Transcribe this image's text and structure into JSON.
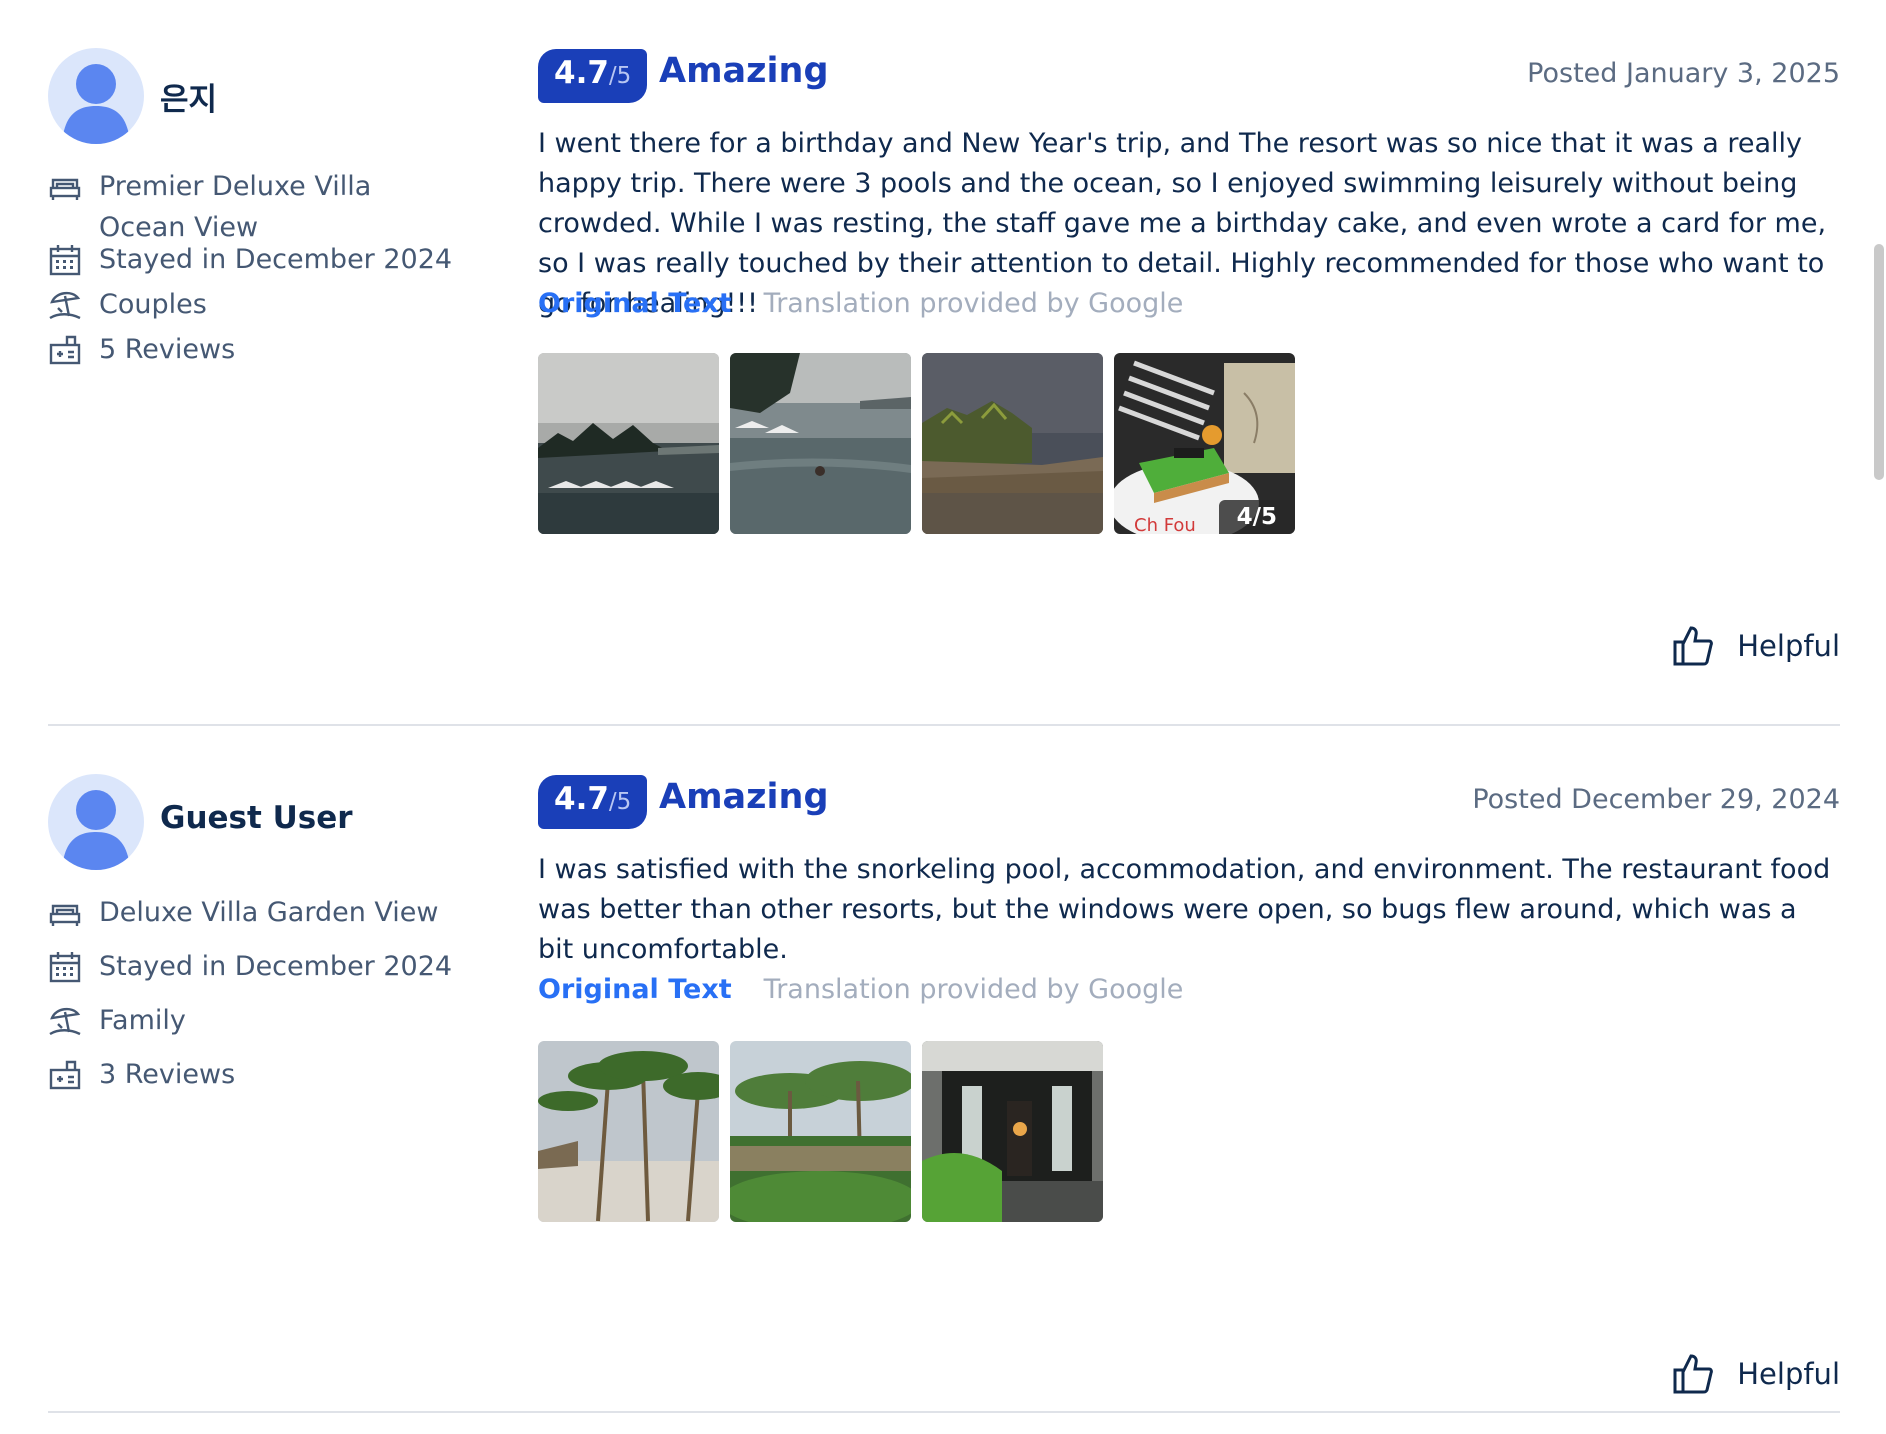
{
  "reviews": [
    {
      "user": {
        "name": "은지",
        "room": "Premier Deluxe Villa Ocean View",
        "stay": "Stayed in December 2024",
        "trip_type": "Couples",
        "review_count": "5 Reviews"
      },
      "score": "4.7",
      "score_max": "/5",
      "score_label": "Amazing",
      "posted": "Posted January 3, 2025",
      "text": "I went there for a birthday and New Year's trip, and The resort was so nice that it was a really happy trip. There were 3 pools and the ocean, so I enjoyed swimming leisurely without being crowded. While I was resting, the staff gave me a birthday cake, and even wrote a card for me, so I was really touched by their attention to detail. Highly recommended for those who want to go for healing!!!",
      "original_link": "Original Text",
      "translation_note": "Translation provided by Google",
      "photo_count": "4/5",
      "helpful_label": "Helpful"
    },
    {
      "user": {
        "name": "Guest User",
        "room": "Deluxe Villa Garden View",
        "stay": "Stayed in December 2024",
        "trip_type": "Family",
        "review_count": "3 Reviews"
      },
      "score": "4.7",
      "score_max": "/5",
      "score_label": "Amazing",
      "posted": "Posted December 29, 2024",
      "text": "I was satisfied with the snorkeling pool, accommodation, and environment. The restaurant food was better than other resorts, but the windows were open, so bugs flew around, which was a bit uncomfortable.",
      "original_link": "Original Text",
      "translation_note": "Translation provided by Google",
      "helpful_label": "Helpful"
    }
  ],
  "colors": {
    "brand": "#1a3fb8",
    "link": "#2870f5",
    "text": "#0f294d",
    "muted": "#5b6b82",
    "divider": "#dfe2e8"
  },
  "icons": {
    "room": "bed-icon",
    "stay": "calendar-icon",
    "trip": "beach-umbrella-icon",
    "reviews": "review-count-icon",
    "helpful": "thumbs-up-icon"
  }
}
